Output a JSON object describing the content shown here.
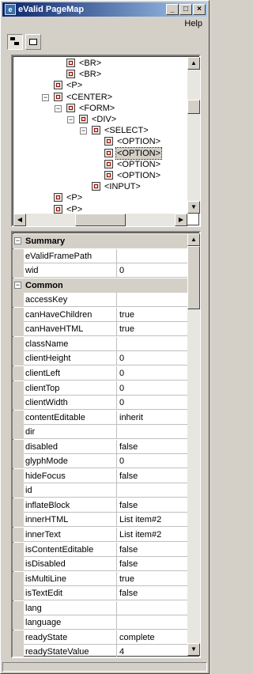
{
  "window": {
    "title": "eValid PageMap"
  },
  "menu": {
    "help": "Help"
  },
  "toolbar": {
    "buttons": [
      {
        "icon": "tree-view-icon"
      },
      {
        "icon": "property-view-icon"
      }
    ]
  },
  "tree": {
    "nodes": [
      {
        "label": "<BR>",
        "level": 4,
        "expander": ""
      },
      {
        "label": "<BR>",
        "level": 4,
        "expander": ""
      },
      {
        "label": "<P>",
        "level": 3,
        "expander": ""
      },
      {
        "label": "<CENTER>",
        "level": 3,
        "expander": "−"
      },
      {
        "label": "<FORM>",
        "level": 4,
        "expander": "−"
      },
      {
        "label": "<DIV>",
        "level": 5,
        "expander": "−"
      },
      {
        "label": "<SELECT>",
        "level": 6,
        "expander": "−"
      },
      {
        "label": "<OPTION>",
        "level": 7,
        "expander": ""
      },
      {
        "label": "<OPTION>",
        "level": 7,
        "expander": "",
        "selected": true
      },
      {
        "label": "<OPTION>",
        "level": 7,
        "expander": ""
      },
      {
        "label": "<OPTION>",
        "level": 7,
        "expander": ""
      },
      {
        "label": "<INPUT>",
        "level": 6,
        "expander": ""
      },
      {
        "label": "<P>",
        "level": 3,
        "expander": ""
      },
      {
        "label": "<P>",
        "level": 3,
        "expander": ""
      }
    ]
  },
  "properties": {
    "rows": [
      {
        "category": "Summary",
        "expander": "−"
      },
      {
        "name": "eValidFramePath",
        "value": ""
      },
      {
        "name": "wid",
        "value": "0"
      },
      {
        "category": "Common",
        "expander": "−"
      },
      {
        "name": "accessKey",
        "value": ""
      },
      {
        "name": "canHaveChildren",
        "value": "true"
      },
      {
        "name": "canHaveHTML",
        "value": "true"
      },
      {
        "name": "className",
        "value": ""
      },
      {
        "name": "clientHeight",
        "value": "0"
      },
      {
        "name": "clientLeft",
        "value": "0"
      },
      {
        "name": "clientTop",
        "value": "0"
      },
      {
        "name": "clientWidth",
        "value": "0"
      },
      {
        "name": "contentEditable",
        "value": "inherit"
      },
      {
        "name": "dir",
        "value": ""
      },
      {
        "name": "disabled",
        "value": "false"
      },
      {
        "name": "glyphMode",
        "value": "0"
      },
      {
        "name": "hideFocus",
        "value": "false"
      },
      {
        "name": "id",
        "value": ""
      },
      {
        "name": "inflateBlock",
        "value": "false"
      },
      {
        "name": "innerHTML",
        "value": "List item#2"
      },
      {
        "name": "innerText",
        "value": "List item#2"
      },
      {
        "name": "isContentEditable",
        "value": "false"
      },
      {
        "name": "isDisabled",
        "value": "false"
      },
      {
        "name": "isMultiLine",
        "value": "true"
      },
      {
        "name": "isTextEdit",
        "value": "false"
      },
      {
        "name": "lang",
        "value": ""
      },
      {
        "name": "language",
        "value": ""
      },
      {
        "name": "readyState",
        "value": "complete"
      },
      {
        "name": "readyStateValue",
        "value": "4"
      }
    ]
  }
}
